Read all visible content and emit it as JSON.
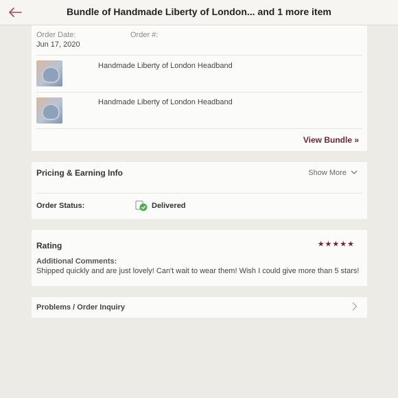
{
  "header": {
    "back_icon": "arrow-left-icon",
    "title": "Bundle of Handmade Liberty of London... and 1 more item"
  },
  "order": {
    "date_label": "Order Date:",
    "date_value": "Jun 17, 2020",
    "number_label": "Order #:",
    "items": [
      {
        "name": "Handmade Liberty of London Headband"
      },
      {
        "name": "Handmade Liberty of London Headband"
      }
    ],
    "view_bundle": "View Bundle »"
  },
  "pricing": {
    "title": "Pricing & Earning Info",
    "show_more": "Show More",
    "status_label": "Order Status:",
    "status_value": "Delivered"
  },
  "rating": {
    "title": "Rating",
    "stars": 5,
    "stars_text": "★★★★★",
    "comments_label": "Additional Comments:",
    "comments_text": "Shipped quickly and are just lovely! Can't wait to wear them! Wish I could give more than 5 stars!"
  },
  "problems": {
    "label": "Problems / Order Inquiry"
  },
  "colors": {
    "accent": "#6e2437",
    "back_arrow": "#a3495a",
    "delivered_check": "#4caf50",
    "background": "#ecebe5"
  }
}
